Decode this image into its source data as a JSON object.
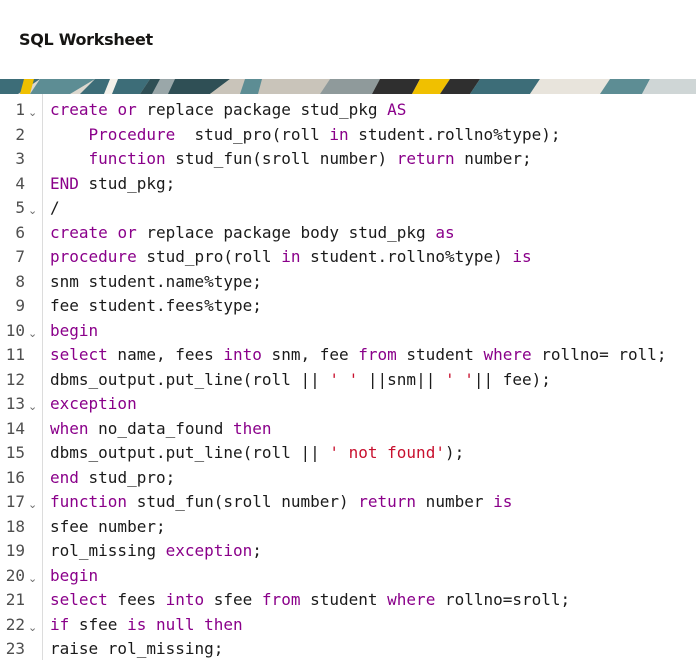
{
  "worksheet": {
    "title": "SQL Worksheet"
  },
  "banner_colors": [
    "#3d6d78",
    "#5d8d94",
    "#f0c000",
    "#2f2f2f",
    "#f4f1ea",
    "#9aa7a9"
  ],
  "editor": {
    "fold_glyph": "⌄",
    "lines": [
      {
        "n": "1",
        "fold": true,
        "tokens": [
          [
            "kw",
            "create"
          ],
          [
            "pl",
            " "
          ],
          [
            "kw",
            "or"
          ],
          [
            "pl",
            " replace package stud_pkg "
          ],
          [
            "kw",
            "AS"
          ]
        ]
      },
      {
        "n": "2",
        "fold": false,
        "tokens": [
          [
            "pl",
            "    "
          ],
          [
            "kw",
            "Procedure"
          ],
          [
            "pl",
            "  stud_pro(roll "
          ],
          [
            "kw",
            "in"
          ],
          [
            "pl",
            " student.rollno%type);"
          ]
        ]
      },
      {
        "n": "3",
        "fold": false,
        "tokens": [
          [
            "pl",
            "    "
          ],
          [
            "kw",
            "function"
          ],
          [
            "pl",
            " stud_fun(sroll number) "
          ],
          [
            "kw",
            "return"
          ],
          [
            "pl",
            " number;"
          ]
        ]
      },
      {
        "n": "4",
        "fold": false,
        "tokens": [
          [
            "kw",
            "END"
          ],
          [
            "pl",
            " stud_pkg;"
          ]
        ]
      },
      {
        "n": "5",
        "fold": true,
        "tokens": [
          [
            "pl",
            "/"
          ]
        ]
      },
      {
        "n": "6",
        "fold": false,
        "tokens": [
          [
            "kw",
            "create"
          ],
          [
            "pl",
            " "
          ],
          [
            "kw",
            "or"
          ],
          [
            "pl",
            " replace package body stud_pkg "
          ],
          [
            "kw",
            "as"
          ]
        ]
      },
      {
        "n": "7",
        "fold": false,
        "tokens": [
          [
            "kw",
            "procedure"
          ],
          [
            "pl",
            " stud_pro(roll "
          ],
          [
            "kw",
            "in"
          ],
          [
            "pl",
            " student.rollno%type) "
          ],
          [
            "kw",
            "is"
          ]
        ]
      },
      {
        "n": "8",
        "fold": false,
        "tokens": [
          [
            "pl",
            "snm student.name%type;"
          ]
        ]
      },
      {
        "n": "9",
        "fold": false,
        "tokens": [
          [
            "pl",
            "fee student.fees%type;"
          ]
        ]
      },
      {
        "n": "10",
        "fold": true,
        "tokens": [
          [
            "kw",
            "begin"
          ]
        ]
      },
      {
        "n": "11",
        "fold": false,
        "tokens": [
          [
            "kw",
            "select"
          ],
          [
            "pl",
            " name, fees "
          ],
          [
            "kw",
            "into"
          ],
          [
            "pl",
            " snm, fee "
          ],
          [
            "kw",
            "from"
          ],
          [
            "pl",
            " student "
          ],
          [
            "kw",
            "where"
          ],
          [
            "pl",
            " rollno= roll;"
          ]
        ]
      },
      {
        "n": "12",
        "fold": false,
        "tokens": [
          [
            "pl",
            "dbms_output.put_line(roll || "
          ],
          [
            "str",
            "' '"
          ],
          [
            "pl",
            " ||snm|| "
          ],
          [
            "str",
            "' '"
          ],
          [
            "pl",
            "|| fee);"
          ]
        ]
      },
      {
        "n": "13",
        "fold": true,
        "tokens": [
          [
            "kw",
            "exception"
          ]
        ]
      },
      {
        "n": "14",
        "fold": false,
        "tokens": [
          [
            "kw",
            "when"
          ],
          [
            "pl",
            " no_data_found "
          ],
          [
            "kw",
            "then"
          ]
        ]
      },
      {
        "n": "15",
        "fold": false,
        "tokens": [
          [
            "pl",
            "dbms_output.put_line(roll || "
          ],
          [
            "str",
            "' not found'"
          ],
          [
            "pl",
            ");"
          ]
        ]
      },
      {
        "n": "16",
        "fold": false,
        "tokens": [
          [
            "kw",
            "end"
          ],
          [
            "pl",
            " stud_pro;"
          ]
        ]
      },
      {
        "n": "17",
        "fold": true,
        "tokens": [
          [
            "kw",
            "function"
          ],
          [
            "pl",
            " stud_fun(sroll number) "
          ],
          [
            "kw",
            "return"
          ],
          [
            "pl",
            " number "
          ],
          [
            "kw",
            "is"
          ]
        ]
      },
      {
        "n": "18",
        "fold": false,
        "tokens": [
          [
            "pl",
            "sfee number;"
          ]
        ]
      },
      {
        "n": "19",
        "fold": false,
        "tokens": [
          [
            "pl",
            "rol_missing "
          ],
          [
            "kw",
            "exception"
          ],
          [
            "pl",
            ";"
          ]
        ]
      },
      {
        "n": "20",
        "fold": true,
        "tokens": [
          [
            "kw",
            "begin"
          ]
        ]
      },
      {
        "n": "21",
        "fold": false,
        "tokens": [
          [
            "kw",
            "select"
          ],
          [
            "pl",
            " fees "
          ],
          [
            "kw",
            "into"
          ],
          [
            "pl",
            " sfee "
          ],
          [
            "kw",
            "from"
          ],
          [
            "pl",
            " student "
          ],
          [
            "kw",
            "where"
          ],
          [
            "pl",
            " rollno=sroll;"
          ]
        ]
      },
      {
        "n": "22",
        "fold": true,
        "tokens": [
          [
            "kw",
            "if"
          ],
          [
            "pl",
            " sfee "
          ],
          [
            "kw",
            "is"
          ],
          [
            "pl",
            " "
          ],
          [
            "kw",
            "null"
          ],
          [
            "pl",
            " "
          ],
          [
            "kw",
            "then"
          ]
        ]
      },
      {
        "n": "23",
        "fold": false,
        "tokens": [
          [
            "pl",
            "raise rol_missing;"
          ]
        ]
      }
    ]
  }
}
